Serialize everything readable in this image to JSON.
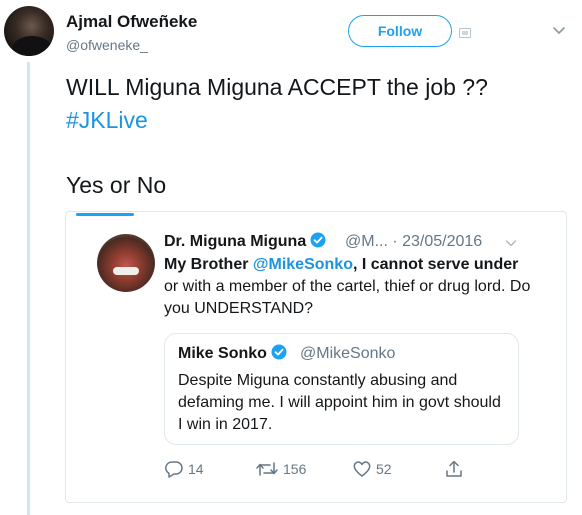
{
  "author": {
    "name": "Ajmal Ofweñeke",
    "handle": "@ofweneke_"
  },
  "header": {
    "follow_label": "Follow"
  },
  "tweet": {
    "text": "WILL Miguna Miguna ACCEPT the job ??",
    "hashtag": "#JKLive",
    "line2": "Yes or No"
  },
  "quoted": {
    "name": "Dr. Miguna Miguna",
    "handle_date": "@M... · 23/05/2016",
    "text_part1": "My Brother ",
    "mention": "@MikeSonko",
    "text_part2": ", I cannot serve under",
    "text_part3": " or with a member of the cartel, thief or drug lord. Do you UNDERSTAND?"
  },
  "nested": {
    "name": "Mike Sonko",
    "handle": "@MikeSonko",
    "text": "Despite Miguna constantly abusing and defaming me. I will appoint him in govt should I win in 2017."
  },
  "actions": {
    "replies": "14",
    "retweets": "156",
    "likes": "52"
  },
  "colors": {
    "accent": "#1da1f2",
    "link": "#1b95e0",
    "muted": "#657786",
    "border": "#e1e8ed",
    "thread": "#cde7f8"
  }
}
